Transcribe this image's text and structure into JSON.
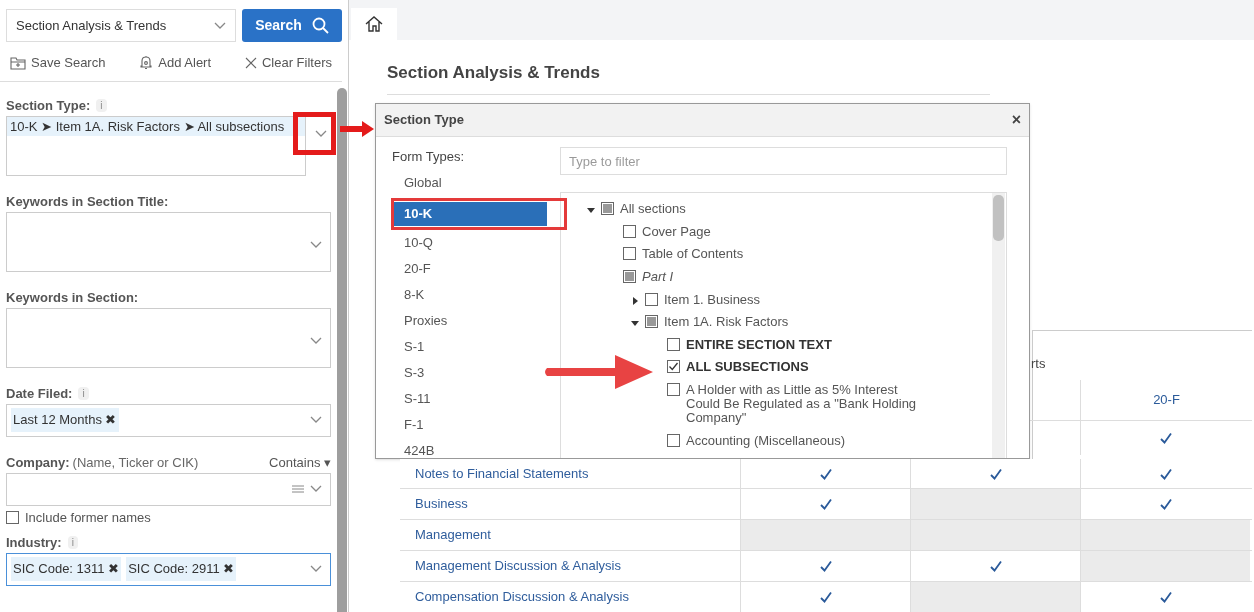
{
  "sidebar": {
    "view_select": {
      "value": "Section Analysis & Trends"
    },
    "search_button": "Search",
    "actions": [
      {
        "kind": "save",
        "label": "Save Search"
      },
      {
        "kind": "alert",
        "label": "Add Alert"
      },
      {
        "kind": "clear",
        "label": "Clear Filters"
      }
    ],
    "filters": [
      {
        "kind": "multi",
        "label": "Section Type:",
        "info": "i",
        "chips": [
          "10-K ➤ Item 1A. Risk Factors ➤ All subsections"
        ]
      },
      {
        "kind": "multi",
        "label": "Keywords in Section Title:"
      },
      {
        "kind": "multi",
        "label": "Keywords in Section:"
      },
      {
        "kind": "single",
        "label": "Date Filed:",
        "info": "i",
        "focused": false,
        "chips": [
          "Last 12 Months ✖"
        ]
      },
      {
        "kind": "company",
        "label": "Company:",
        "hint": "(Name, Ticker or CIK)",
        "mode": "Contains ▾"
      },
      {
        "kind": "checkbox",
        "label": "Include former names",
        "checked": false
      },
      {
        "kind": "single",
        "label": "Industry:",
        "info": "i",
        "focused": true,
        "chips": [
          "SIC Code: 1311 ✖",
          "SIC Code: 2911 ✖"
        ]
      }
    ]
  },
  "page_title": "Section Analysis & Trends",
  "dialog": {
    "title": "Section Type",
    "close": "×",
    "form_types_label": "Form Types:",
    "filter_placeholder": "Type to filter",
    "form_types": [
      {
        "label": "Global",
        "selected": false
      },
      {
        "label": "10-K",
        "selected": true
      },
      {
        "label": "10-Q",
        "selected": false
      },
      {
        "label": "20-F",
        "selected": false
      },
      {
        "label": "8-K",
        "selected": false
      },
      {
        "label": "Proxies",
        "selected": false
      },
      {
        "label": "S-1",
        "selected": false
      },
      {
        "label": "S-3",
        "selected": false
      },
      {
        "label": "S-11",
        "selected": false
      },
      {
        "label": "F-1",
        "selected": false
      },
      {
        "label": "424B",
        "selected": false
      }
    ],
    "tree": [
      {
        "label": "All sections",
        "checked": false,
        "mixed": true,
        "expanded": true,
        "children": [
          {
            "label": "Cover Page",
            "checked": false,
            "mixed": false
          },
          {
            "label": "Table of Contents",
            "checked": false,
            "mixed": false
          },
          {
            "label": "Part I",
            "kind": "part",
            "checked": false,
            "mixed": true,
            "children": [
              {
                "label": "Item 1. Business",
                "checked": false,
                "mixed": false,
                "expanded": false
              },
              {
                "label": "Item 1A. Risk Factors",
                "checked": false,
                "mixed": true,
                "expanded": true,
                "children": [
                  {
                    "label": "ENTIRE SECTION TEXT",
                    "kind": "special",
                    "checked": false,
                    "mixed": false
                  },
                  {
                    "label": "ALL SUBSECTIONS",
                    "kind": "special",
                    "checked": true,
                    "mixed": false
                  },
                  {
                    "label": "A Holder with as Little as 5% Interest Could Be Regulated as a \"Bank Holding Company\"",
                    "checked": false,
                    "mixed": false
                  },
                  {
                    "label": "Accounting (Miscellaneous)",
                    "checked": false,
                    "mixed": false
                  }
                ]
              }
            ]
          }
        ]
      }
    ]
  },
  "table": {
    "group_header_fragment": "rts",
    "columns": [
      {
        "label": "20-F"
      }
    ],
    "rows": [
      {
        "cells": [
          {
            "kind": "hidden"
          },
          {
            "kind": "hidden"
          },
          {
            "kind": "check"
          }
        ]
      },
      {
        "label": "Notes to Financial Statements",
        "cells": [
          {
            "kind": "check"
          },
          {
            "kind": "check"
          },
          {
            "kind": "check"
          }
        ]
      },
      {
        "label": "Business",
        "cells": [
          {
            "kind": "check"
          },
          {
            "kind": "na"
          },
          {
            "kind": "check"
          }
        ]
      },
      {
        "label": "Management",
        "cells": [
          {
            "kind": "na"
          },
          {
            "kind": "na"
          },
          {
            "kind": "na"
          }
        ]
      },
      {
        "label": "Management Discussion & Analysis",
        "cells": [
          {
            "kind": "check"
          },
          {
            "kind": "check"
          },
          {
            "kind": "na"
          }
        ]
      },
      {
        "label": "Compensation Discussion & Analysis",
        "cells": [
          {
            "kind": "check"
          },
          {
            "kind": "na"
          },
          {
            "kind": "check"
          }
        ]
      }
    ]
  }
}
